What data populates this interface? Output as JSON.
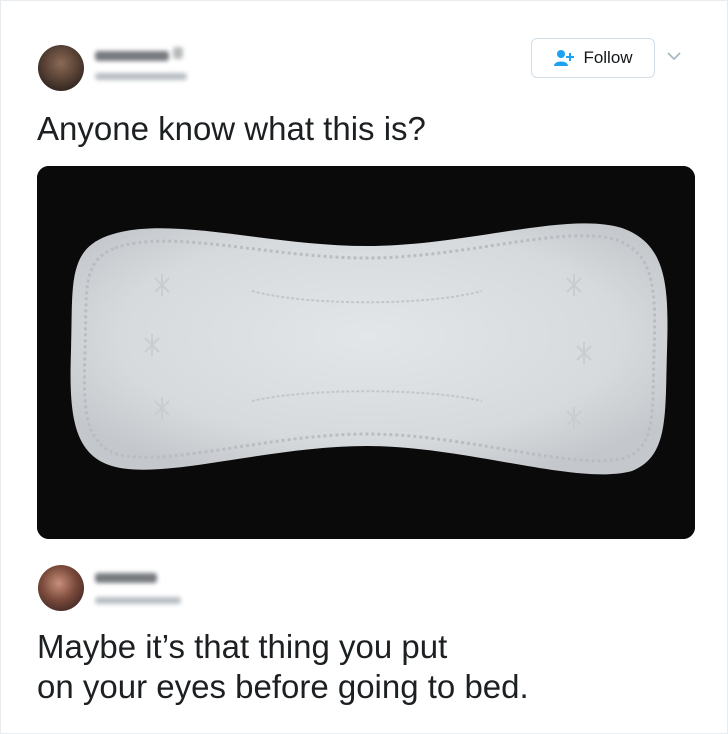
{
  "tweet": {
    "text": "Anyone know what this is?",
    "follow_label": "Follow"
  },
  "reply": {
    "text": "Maybe it’s that thing you put\non your eyes before going to bed."
  },
  "icons": {
    "follow": "add-person-icon",
    "menu": "chevron-down-icon"
  },
  "colors": {
    "accent": "#1da1f2",
    "text": "#1c2022",
    "photo_background": "#0b0a0b",
    "pad": "#dde0e4"
  }
}
